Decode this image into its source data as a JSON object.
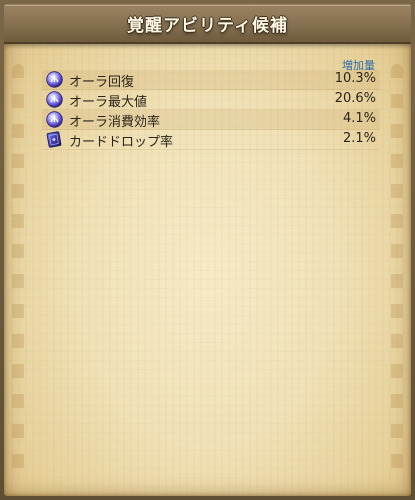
{
  "window": {
    "title": "覚醒アビリティ候補"
  },
  "table": {
    "column_header": "増加量",
    "rows": [
      {
        "icon": "aura-orb-icon",
        "label": "オーラ回復",
        "value": "10.3%"
      },
      {
        "icon": "aura-orb-icon",
        "label": "オーラ最大値",
        "value": "20.6%"
      },
      {
        "icon": "aura-orb-icon",
        "label": "オーラ消費効率",
        "value": "4.1%"
      },
      {
        "icon": "card-icon",
        "label": "カードドロップ率",
        "value": "2.1%"
      }
    ]
  },
  "colors": {
    "header_text": "#2c6ea8",
    "title_text": "#fff8e6",
    "parchment": "#f0e1b6",
    "title_bar": "#85704f"
  }
}
